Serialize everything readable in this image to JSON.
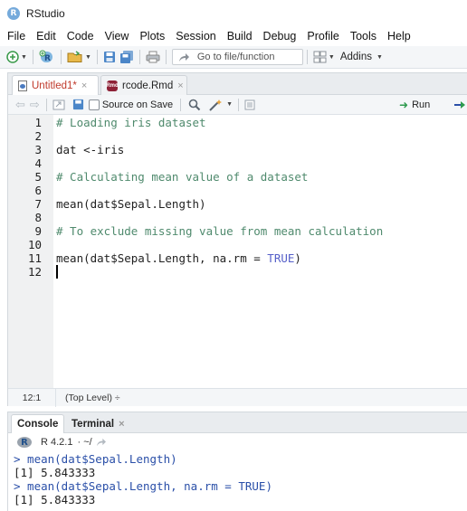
{
  "window": {
    "title": "RStudio"
  },
  "menu": [
    "File",
    "Edit",
    "Code",
    "View",
    "Plots",
    "Session",
    "Build",
    "Debug",
    "Profile",
    "Tools",
    "Help"
  ],
  "toolbar": {
    "goto_placeholder": "Go to file/function",
    "addins_label": "Addins"
  },
  "source": {
    "tabs": [
      {
        "label": "Untitled1*",
        "active": true
      },
      {
        "label": "rcode.Rmd",
        "active": false
      }
    ],
    "source_on_save_label": "Source on Save",
    "run_label": "Run",
    "line_numbers": [
      "1",
      "2",
      "3",
      "4",
      "5",
      "6",
      "7",
      "8",
      "9",
      "10",
      "11",
      "12"
    ],
    "lines": [
      {
        "text": "# Loading iris dataset",
        "kind": "comment"
      },
      {
        "text": "",
        "kind": "code"
      },
      {
        "text": "dat <-iris",
        "kind": "code"
      },
      {
        "text": "",
        "kind": "code"
      },
      {
        "text": "# Calculating mean value of a dataset",
        "kind": "comment"
      },
      {
        "text": "",
        "kind": "code"
      },
      {
        "text": "mean(dat$Sepal.Length)",
        "kind": "code"
      },
      {
        "text": "",
        "kind": "code"
      },
      {
        "text": "# To exclude missing value from mean calculation",
        "kind": "comment"
      },
      {
        "text": "",
        "kind": "code"
      },
      {
        "text": "mean(dat$Sepal.Length, na.rm = ",
        "kind": "code",
        "suffix": "TRUE",
        "tail": ")"
      },
      {
        "text": "",
        "kind": "code"
      }
    ],
    "status_position": "12:1",
    "status_scope": "(Top Level) ÷"
  },
  "console": {
    "tabs": [
      "Console",
      "Terminal"
    ],
    "version": "R 4.2.1",
    "path": "· ~/",
    "lines": [
      {
        "text": "> mean(dat$Sepal.Length)",
        "kind": "cmd"
      },
      {
        "text": "[1] 5.843333",
        "kind": "out"
      },
      {
        "text": "> mean(dat$Sepal.Length, na.rm = TRUE)",
        "kind": "cmd"
      },
      {
        "text": "[1] 5.843333",
        "kind": "out"
      }
    ]
  },
  "colors": {
    "comment": "#4f8a6d",
    "constant": "#5660c9",
    "console_command": "#2a4fa8",
    "active_tab_text": "#c0392b",
    "run_arrow": "#2e9a4e"
  },
  "icons": [
    "new-file-icon",
    "new-project-icon",
    "open-folder-icon",
    "save-icon",
    "save-all-icon",
    "print-icon",
    "goto-arrow-icon",
    "grid-icon",
    "back-arrow-icon",
    "forward-arrow-icon",
    "show-in-window-icon",
    "search-icon",
    "wand-icon",
    "outline-icon",
    "run-icon",
    "rerun-icon"
  ]
}
